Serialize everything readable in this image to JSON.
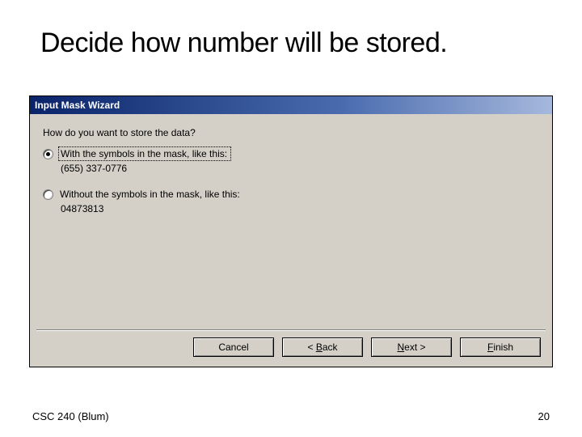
{
  "slide": {
    "title": "Decide how number will be stored.",
    "footer_left": "CSC 240 (Blum)",
    "footer_right": "20"
  },
  "dialog": {
    "title": "Input Mask Wizard",
    "question": "How do you want to store the data?",
    "options": [
      {
        "label": "With the symbols in the mask, like this:",
        "example": "(655) 337-0776",
        "checked": true
      },
      {
        "label": "Without the symbols in the mask, like this:",
        "example": "04873813",
        "checked": false
      }
    ],
    "buttons": {
      "cancel": "Cancel",
      "back": "< Back",
      "next": "Next >",
      "finish": "Finish"
    }
  }
}
